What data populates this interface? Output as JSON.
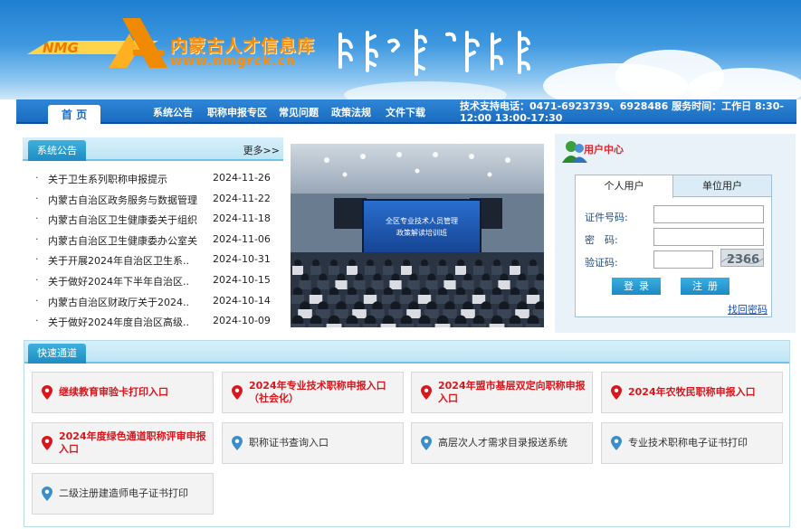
{
  "colors": {
    "accent": "#1a6cc0",
    "brand_orange": "#ff8c00",
    "hot_red": "#d9161c",
    "pin_blue": "#3b8fc8"
  },
  "header": {
    "logo_text": "NMG",
    "site_title": "内蒙古人才信息库",
    "site_url": "www.nmgrck.cn",
    "mongolian_title": "ᠮᠣᠩᠭᠣᠯ"
  },
  "nav": {
    "home": "首 页",
    "items": [
      "系统公告",
      "职称申报专区",
      "常见问题",
      "政策法规",
      "文件下载"
    ],
    "support_text": "技术支持电话：0471-6923739、6928486   服务时间：工作日 8:30-12:00 13:00-17:30"
  },
  "notice": {
    "tab_label": "系统公告",
    "more_label": "更多>>",
    "items": [
      {
        "title": "关于卫生系列职称申报提示",
        "date": "2024-11-26"
      },
      {
        "title": "内蒙古自治区政务服务与数据管理..",
        "date": "2024-11-22"
      },
      {
        "title": "内蒙古自治区卫生健康委关于组织..",
        "date": "2024-11-18"
      },
      {
        "title": "内蒙古自治区卫生健康委办公室关..",
        "date": "2024-11-06"
      },
      {
        "title": "关于开展2024年自治区卫生系..",
        "date": "2024-10-31"
      },
      {
        "title": "关于做好2024年下半年自治区..",
        "date": "2024-10-15"
      },
      {
        "title": "内蒙古自治区财政厅关于2024..",
        "date": "2024-10-14"
      },
      {
        "title": "关于做好2024年度自治区高级..",
        "date": "2024-10-09"
      }
    ]
  },
  "photo": {
    "screen_title": "全区专业技术人员管理",
    "screen_subtitle": "政策解读培训班"
  },
  "user_center": {
    "title": "用户中心",
    "tabs": [
      "个人用户",
      "单位用户"
    ],
    "id_label": "证件号码:",
    "password_label": "密　码:",
    "captcha_label": "验证码:",
    "captcha_text": "2366",
    "login_button": "登录",
    "register_button": "注册",
    "forgot_link": "找回密码"
  },
  "quick": {
    "tab_label": "快速通道",
    "buttons": [
      {
        "label": "继续教育审验卡打印入口",
        "hot": true
      },
      {
        "label": "2024年专业技术职称申报入口（社会化）",
        "hot": true
      },
      {
        "label": "2024年盟市基层双定向职称申报入口",
        "hot": true
      },
      {
        "label": "2024年农牧民职称申报入口",
        "hot": true
      },
      {
        "label": "2024年度绿色通道职称评审申报入口",
        "hot": true
      },
      {
        "label": "职称证书查询入口",
        "hot": false
      },
      {
        "label": "高层次人才需求目录报送系统",
        "hot": false
      },
      {
        "label": "专业技术职称电子证书打印",
        "hot": false
      },
      {
        "label": "二级注册建造师电子证书打印",
        "hot": false
      }
    ]
  }
}
